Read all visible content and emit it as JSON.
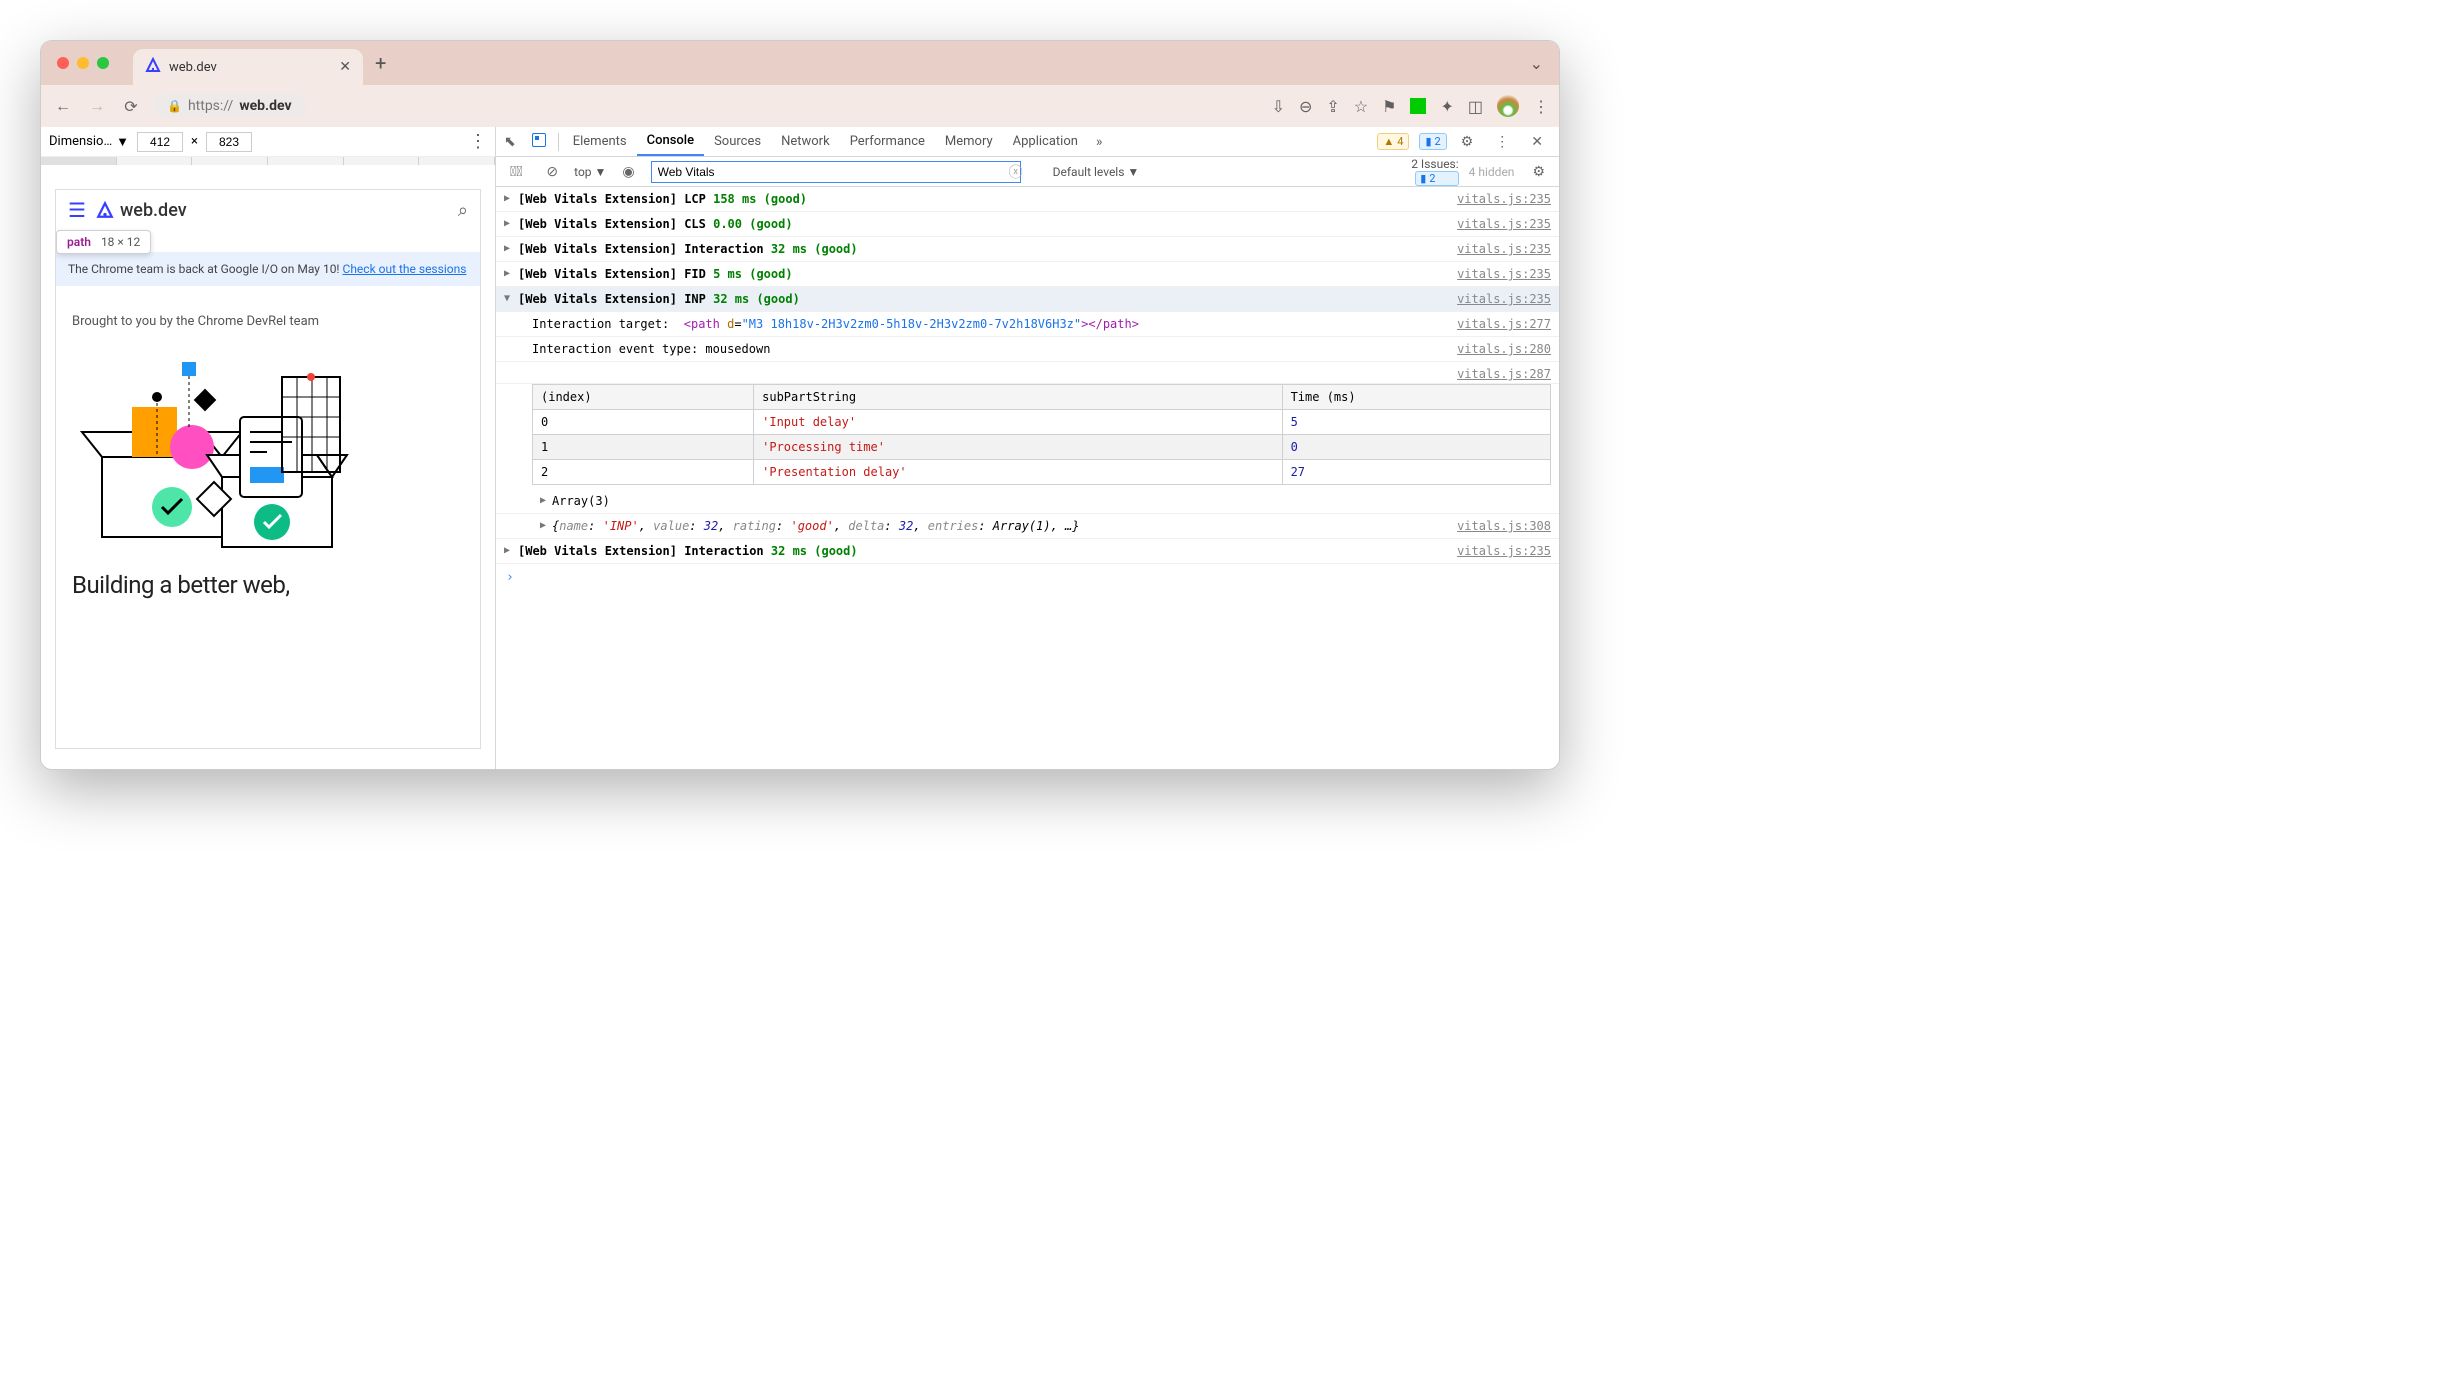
{
  "browser": {
    "tab_title": "web.dev",
    "url_scheme": "https://",
    "url_host": "web.dev"
  },
  "device_toolbar": {
    "label": "Dimensio…",
    "width": "412",
    "height": "823",
    "separator": "×"
  },
  "tooltip": {
    "tag": "path",
    "dims": "18 × 12"
  },
  "preview": {
    "site_name": "web.dev",
    "banner_text": "The Chrome team is back at Google I/O on May 10! ",
    "banner_link": "Check out the sessions",
    "subtitle": "Brought to you by the Chrome DevRel team",
    "heading": "Building a better web,"
  },
  "devtools_tabs": [
    "Elements",
    "Console",
    "Sources",
    "Network",
    "Performance",
    "Memory",
    "Application"
  ],
  "devtools_active": "Console",
  "warn_count": "4",
  "info_count": "2",
  "filter": {
    "scope": "top",
    "value": "Web Vitals",
    "levels": "Default levels",
    "issues_label": "2 Issues:",
    "issues_count": "2",
    "hidden": "4 hidden"
  },
  "logs": [
    {
      "prefix": "[Web Vitals Extension]",
      "metric": "LCP",
      "value": "158 ms (good)",
      "src": "vitals.js:235"
    },
    {
      "prefix": "[Web Vitals Extension]",
      "metric": "CLS",
      "value": "0.00 (good)",
      "src": "vitals.js:235"
    },
    {
      "prefix": "[Web Vitals Extension]",
      "metric": "Interaction",
      "value": "32 ms (good)",
      "src": "vitals.js:235"
    },
    {
      "prefix": "[Web Vitals Extension]",
      "metric": "FID",
      "value": "5 ms (good)",
      "src": "vitals.js:235"
    },
    {
      "prefix": "[Web Vitals Extension]",
      "metric": "INP",
      "value": "32 ms (good)",
      "src": "vitals.js:235",
      "expanded": true
    },
    {
      "prefix": "[Web Vitals Extension]",
      "metric": "Interaction",
      "value": "32 ms (good)",
      "src": "vitals.js:235"
    }
  ],
  "inp_details": {
    "target_label": "Interaction target:",
    "target_html": {
      "tag": "path",
      "attr": "d",
      "val": "\"M3 18h18v-2H3v2zm0-5h18v-2H3v2zm0-7v2h18V6H3z\""
    },
    "target_src": "vitals.js:277",
    "event_label": "Interaction event type:",
    "event_val": "mousedown",
    "event_src": "vitals.js:280",
    "table_src": "vitals.js:287",
    "table_headers": [
      "(index)",
      "subPartString",
      "Time (ms)"
    ],
    "table_rows": [
      {
        "idx": "0",
        "str": "'Input delay'",
        "num": "5"
      },
      {
        "idx": "1",
        "str": "'Processing time'",
        "num": "0"
      },
      {
        "idx": "2",
        "str": "'Presentation delay'",
        "num": "27"
      }
    ],
    "array_label": "Array(3)",
    "obj_text": "{name: 'INP', value: 32, rating: 'good', delta: 32, entries: Array(1), …}",
    "obj_src": "vitals.js:308"
  }
}
